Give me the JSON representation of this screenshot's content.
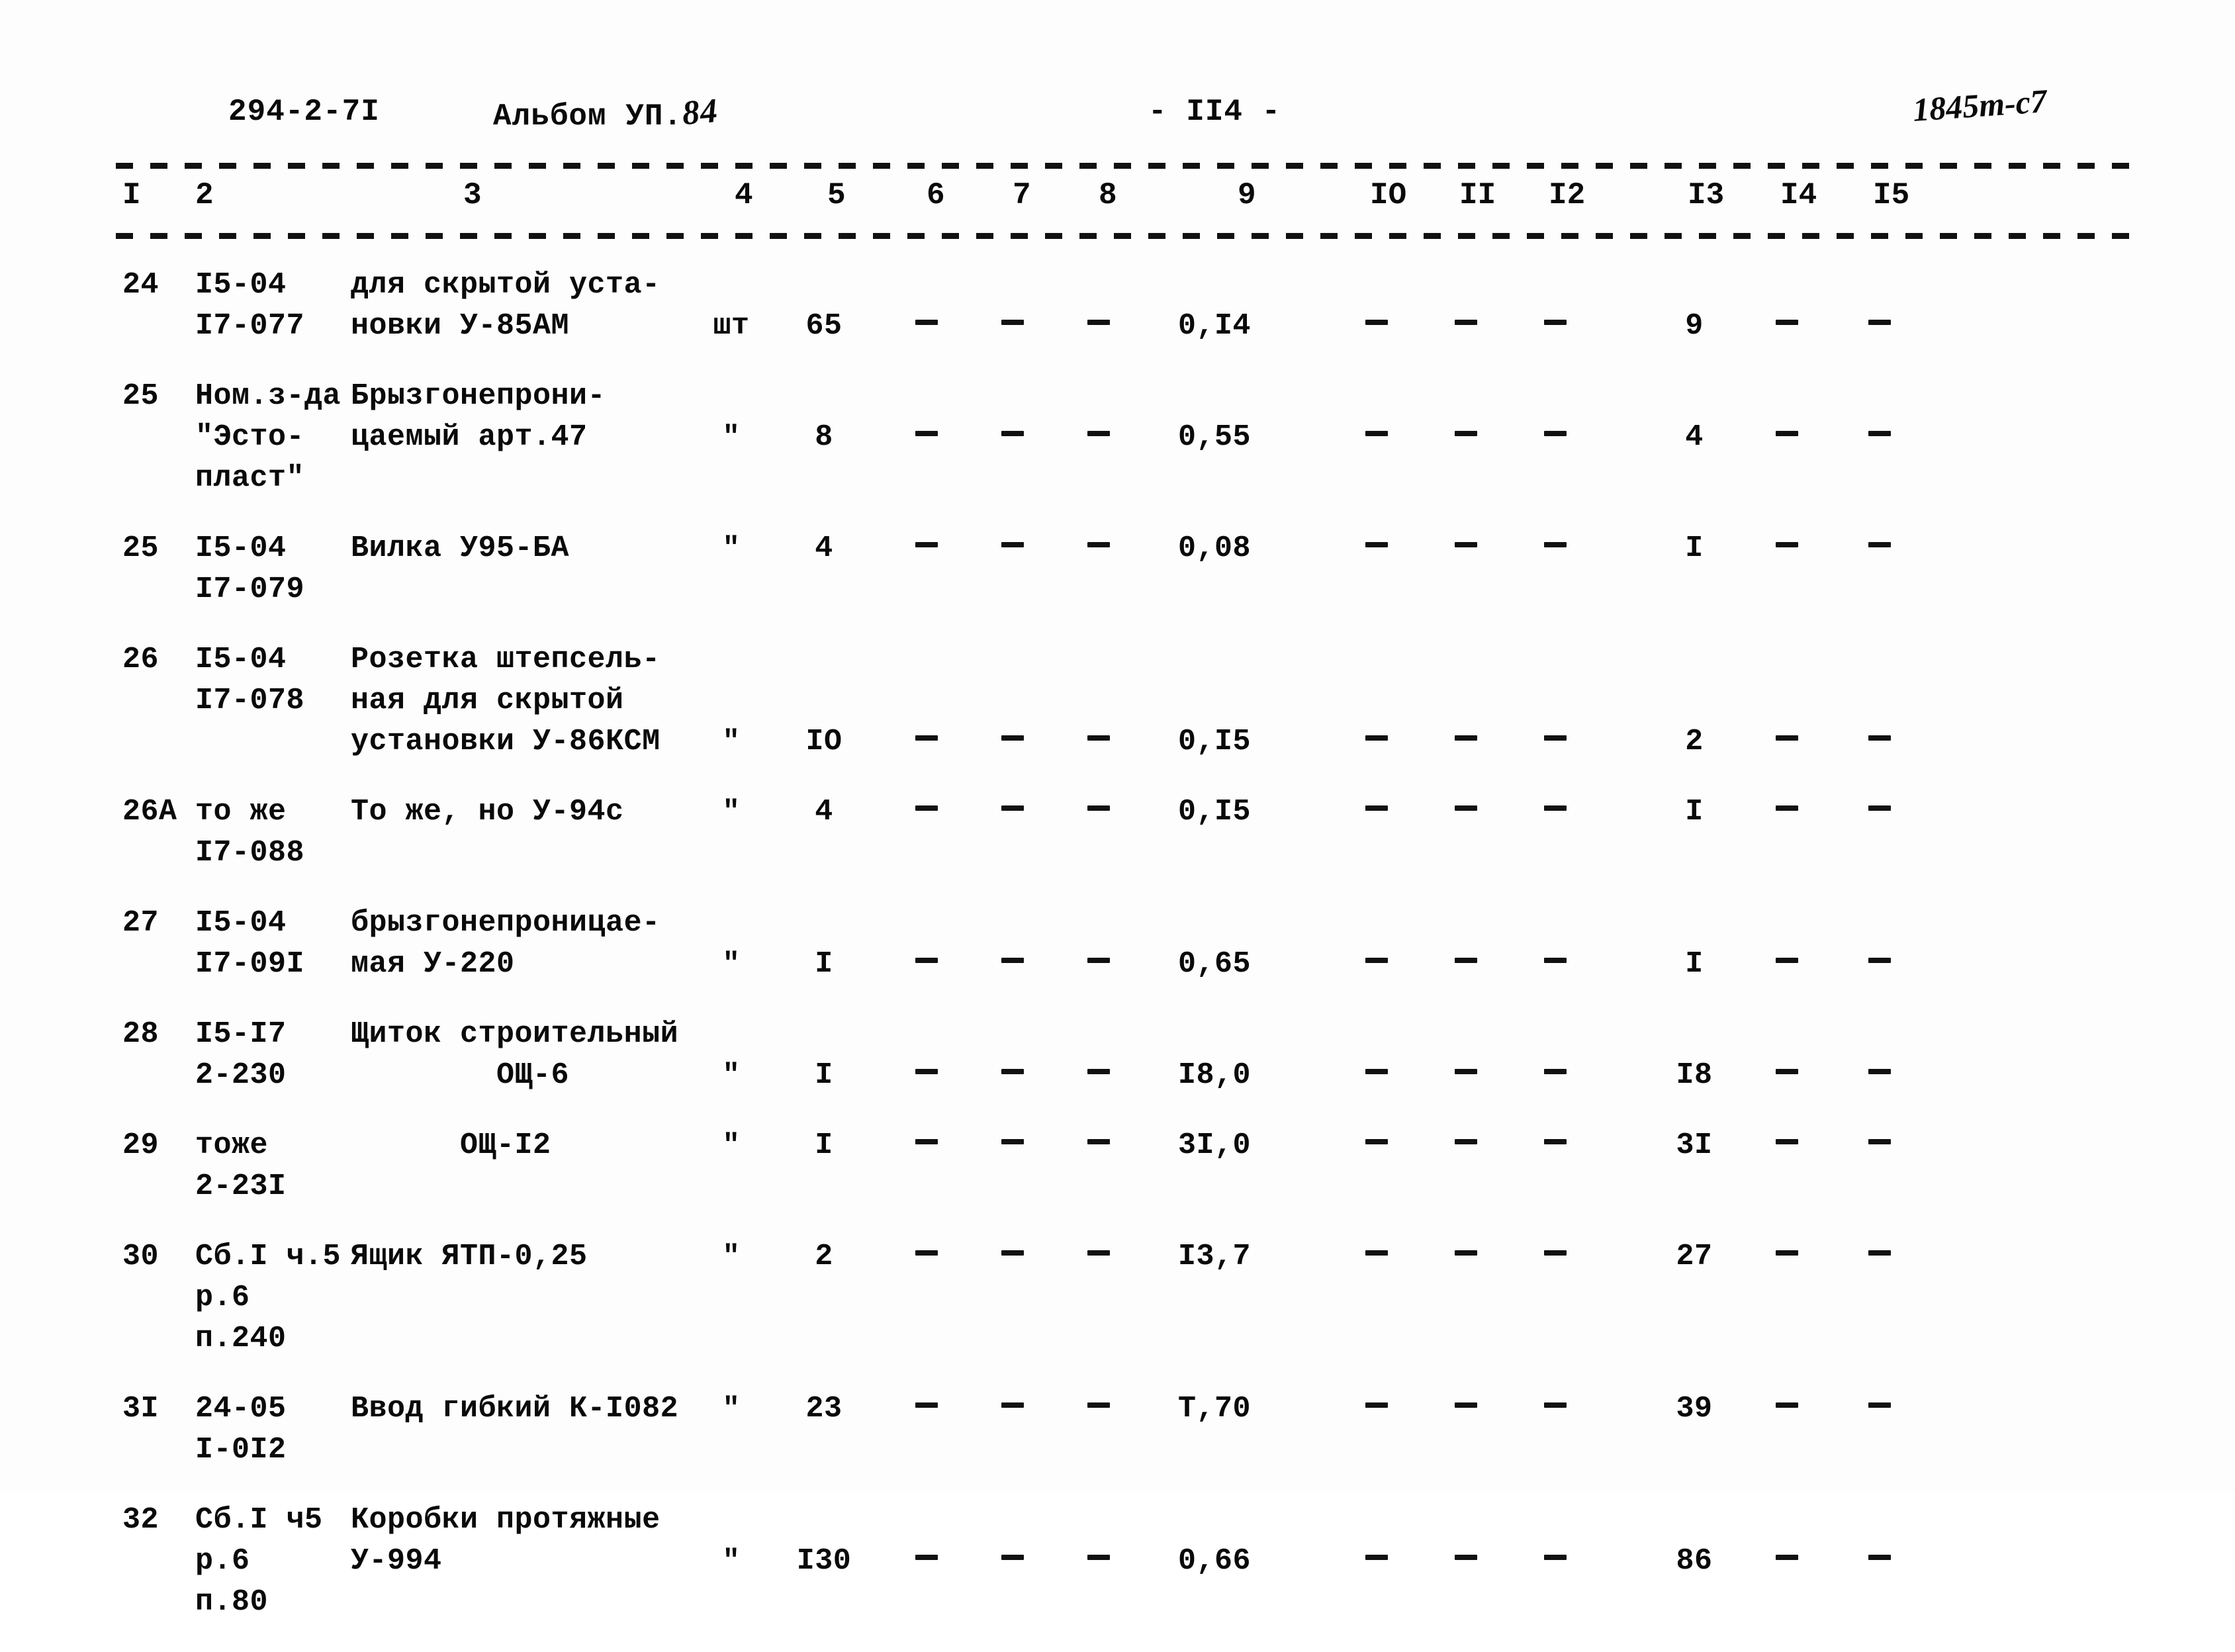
{
  "header": {
    "doc_code": "294-2-7I",
    "album_label": "Альбом УП.",
    "album_number": "84",
    "page_number": "- II4 -",
    "stamp": "1845т-с7"
  },
  "table": {
    "column_headers": [
      "I",
      "2",
      "3",
      "4",
      "5",
      "6",
      "7",
      "8",
      "9",
      "IO",
      "II",
      "I2",
      "I3",
      "I4",
      "I5"
    ],
    "dash": "—",
    "rows": [
      {
        "no": "24",
        "code_lines": [
          "I5-04",
          "I7-077"
        ],
        "desc_lines": [
          "для скрытой уста-",
          "новки У-85АМ"
        ],
        "unit": "шт",
        "qty": "65",
        "c6": "—",
        "c7": "—",
        "c8": "—",
        "c9": "0,I4",
        "c10": "—",
        "c11": "—",
        "c12": "—",
        "c13": "9",
        "c14": "—",
        "c15": "—",
        "desc_value_line": 1
      },
      {
        "no": "25",
        "code_lines": [
          "Ном.з-да",
          "\"Эсто-",
          "пласт\""
        ],
        "desc_lines": [
          "Брызгонепрони-",
          "цаемый арт.47"
        ],
        "unit": "\"",
        "qty": "8",
        "c6": "—",
        "c7": "—",
        "c8": "—",
        "c9": "0,55",
        "c10": "—",
        "c11": "—",
        "c12": "—",
        "c13": "4",
        "c14": "—",
        "c15": "—",
        "desc_value_line": 1
      },
      {
        "no": "25",
        "code_lines": [
          "I5-04",
          "I7-079"
        ],
        "desc_lines": [
          "Вилка У95-БА"
        ],
        "unit": "\"",
        "qty": "4",
        "c6": "—",
        "c7": "—",
        "c8": "—",
        "c9": "0,08",
        "c10": "—",
        "c11": "—",
        "c12": "—",
        "c13": "I",
        "c14": "—",
        "c15": "—",
        "desc_value_line": 0
      },
      {
        "no": "26",
        "code_lines": [
          "I5-04",
          "I7-078"
        ],
        "desc_lines": [
          "Розетка штепсель-",
          "ная для скрытой",
          "установки У-86КСМ"
        ],
        "unit": "\"",
        "qty": "IO",
        "c6": "—",
        "c7": "—",
        "c8": "—",
        "c9": "0,I5",
        "c10": "—",
        "c11": "—",
        "c12": "—",
        "c13": "2",
        "c14": "—",
        "c15": "—",
        "desc_value_line": 2
      },
      {
        "no": "26А",
        "code_lines": [
          "то же",
          "I7-088"
        ],
        "desc_lines": [
          "То же, но У-94с"
        ],
        "unit": "\"",
        "qty": "4",
        "c6": "—",
        "c7": "—",
        "c8": "—",
        "c9": "0,I5",
        "c10": "—",
        "c11": "—",
        "c12": "—",
        "c13": "I",
        "c14": "—",
        "c15": "—",
        "desc_value_line": 0
      },
      {
        "no": "27",
        "code_lines": [
          "I5-04",
          "I7-09I"
        ],
        "desc_lines": [
          "брызгонепроницае-",
          "мая У-220"
        ],
        "unit": "\"",
        "qty": "I",
        "c6": "—",
        "c7": "—",
        "c8": "—",
        "c9": "0,65",
        "c10": "—",
        "c11": "—",
        "c12": "—",
        "c13": "I",
        "c14": "—",
        "c15": "—",
        "desc_value_line": 1
      },
      {
        "no": "28",
        "code_lines": [
          "I5-I7",
          "2-230"
        ],
        "desc_lines": [
          "Щиток строительный",
          "        ОЩ-6"
        ],
        "unit": "\"",
        "qty": "I",
        "c6": "—",
        "c7": "—",
        "c8": "—",
        "c9": "I8,0",
        "c10": "—",
        "c11": "—",
        "c12": "—",
        "c13": "I8",
        "c14": "—",
        "c15": "—",
        "desc_value_line": 1
      },
      {
        "no": "29",
        "code_lines": [
          "тоже",
          "2-23I"
        ],
        "desc_lines": [
          "      ОЩ-I2"
        ],
        "unit": "\"",
        "qty": "I",
        "c6": "—",
        "c7": "—",
        "c8": "—",
        "c9": "3I,0",
        "c10": "—",
        "c11": "—",
        "c12": "—",
        "c13": "3I",
        "c14": "—",
        "c15": "—",
        "desc_value_line": 0
      },
      {
        "no": "30",
        "code_lines": [
          "Сб.I ч.5",
          "р.6",
          "п.240"
        ],
        "desc_lines": [
          "Ящик ЯТП-0,25"
        ],
        "unit": "\"",
        "qty": "2",
        "c6": "—",
        "c7": "—",
        "c8": "—",
        "c9": "I3,7",
        "c10": "—",
        "c11": "—",
        "c12": "—",
        "c13": "27",
        "c14": "—",
        "c15": "—",
        "desc_value_line": 0
      },
      {
        "no": "3I",
        "code_lines": [
          "24-05",
          "I-0I2"
        ],
        "desc_lines": [
          "Ввод гибкий К-I082"
        ],
        "unit": "\"",
        "qty": "23",
        "c6": "—",
        "c7": "—",
        "c8": "—",
        "c9": "Т,70",
        "c10": "—",
        "c11": "—",
        "c12": "—",
        "c13": "39",
        "c14": "—",
        "c15": "—",
        "desc_value_line": 0
      },
      {
        "no": "32",
        "code_lines": [
          "Сб.I ч5",
          "р.6",
          "п.80"
        ],
        "desc_lines": [
          "Коробки протяжные",
          "У-994"
        ],
        "unit": "\"",
        "qty": "I30",
        "c6": "—",
        "c7": "—",
        "c8": "—",
        "c9": "0,66",
        "c10": "—",
        "c11": "—",
        "c12": "—",
        "c13": "86",
        "c14": "—",
        "c15": "—",
        "desc_value_line": 1
      }
    ]
  }
}
